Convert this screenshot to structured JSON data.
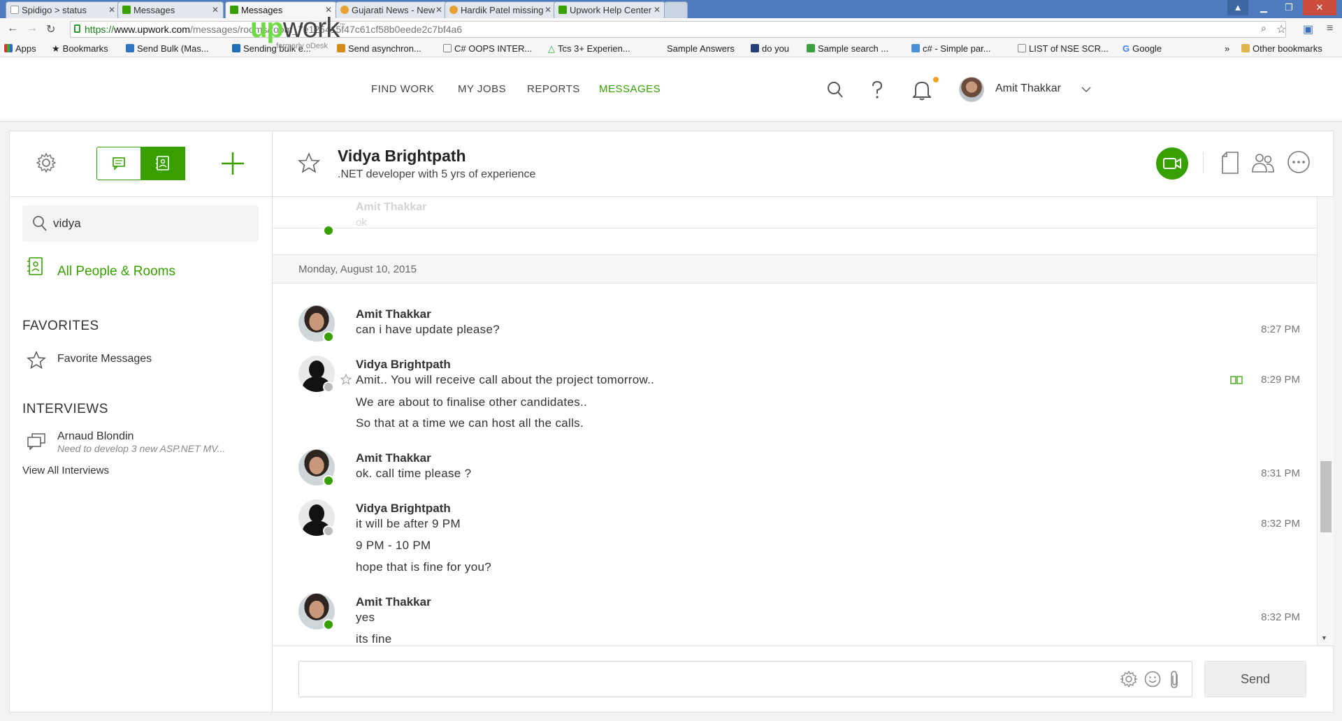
{
  "browser": {
    "tabs": [
      {
        "title": "Spidigo > status",
        "active": false
      },
      {
        "title": "Messages",
        "active": false
      },
      {
        "title": "Messages",
        "active": true
      },
      {
        "title": "Gujarati News - New",
        "active": false
      },
      {
        "title": "Hardik Patel missing",
        "active": false
      },
      {
        "title": "Upwork Help Center",
        "active": false
      }
    ],
    "url_scheme": "https://",
    "url_host": "www.upwork.com",
    "url_path": "/messages/rooms/room_7e125415f47c61cf58b0eede2c7bf4a6",
    "bookmarks": [
      "Apps",
      "Bookmarks",
      "Send Bulk (Mas...",
      "Sending bulk e...",
      "Send asynchron...",
      "C# OOPS INTER...",
      "Tcs 3+ Experien...",
      "Sample Answers",
      "do you",
      "Sample search ...",
      "c# - Simple par...",
      "LIST of NSE SCR...",
      "Google",
      "Other bookmarks"
    ],
    "bookmarks_overflow": "»"
  },
  "header": {
    "logo_up": "up",
    "logo_work": "work",
    "logo_tm": "™",
    "logo_sub": "formerly oDesk",
    "nav": [
      "FIND WORK",
      "MY JOBS",
      "REPORTS",
      "MESSAGES"
    ],
    "active_nav": "MESSAGES",
    "user_name": "Amit Thakkar"
  },
  "sidebar": {
    "search_value": "vidya",
    "all_people": "All People & Rooms",
    "favorites_heading": "FAVORITES",
    "favorite_messages": "Favorite Messages",
    "interviews_heading": "INTERVIEWS",
    "interview": {
      "name": "Arnaud Blondin",
      "subtitle": "Need to develop 3 new ASP.NET MV..."
    },
    "view_all": "View All Interviews"
  },
  "room": {
    "title": "Vidya Brightpath",
    "subtitle": ".NET developer with 5 yrs of experience"
  },
  "thread": {
    "faded": {
      "sender": "Amit Thakkar",
      "text": "ok"
    },
    "date": "Monday, August 10, 2015",
    "messages": [
      {
        "sender": "Amit Thakkar",
        "lines": [
          "can i have update please?"
        ],
        "time": "8:27 PM"
      },
      {
        "sender": "Vidya Brightpath",
        "lines": [
          "Amit.. You will receive call about the project tomorrow..",
          "We are about to finalise other candidates..",
          "So that at a time we can host all the calls."
        ],
        "time": "8:29 PM"
      },
      {
        "sender": "Amit Thakkar",
        "lines": [
          "ok. call time please ?"
        ],
        "time": "8:31 PM"
      },
      {
        "sender": "Vidya Brightpath",
        "lines": [
          "it will be after 9 PM",
          "9 PM - 10 PM",
          "hope that is fine for you?"
        ],
        "time": "8:32 PM"
      },
      {
        "sender": "Amit Thakkar",
        "lines": [
          "yes",
          "its fine"
        ],
        "time": "8:32 PM"
      }
    ]
  },
  "composer": {
    "placeholder": "",
    "send_label": "Send"
  },
  "colors": {
    "brand_green": "#37a000",
    "logo_green": "#6fda44",
    "chrome_blue": "#4d7bbd"
  }
}
